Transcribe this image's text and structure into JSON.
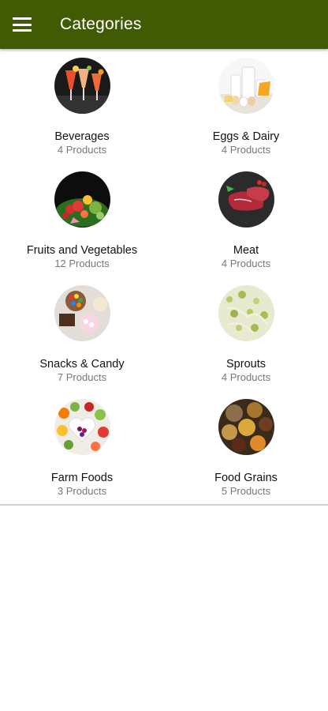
{
  "appbar": {
    "title": "Categories",
    "menu_icon": "hamburger-menu-icon",
    "color": "#405b04"
  },
  "categories": [
    {
      "name": "Beverages",
      "count": "4 Products",
      "image": "beverages-image"
    },
    {
      "name": "Eggs & Dairy",
      "count": "4 Products",
      "image": "eggs-dairy-image"
    },
    {
      "name": "Fruits and Vegetables",
      "count": "12 Products",
      "image": "fruits-vegetables-image"
    },
    {
      "name": "Meat",
      "count": "4 Products",
      "image": "meat-image"
    },
    {
      "name": "Snacks & Candy",
      "count": "7 Products",
      "image": "snacks-candy-image"
    },
    {
      "name": "Sprouts",
      "count": "4 Products",
      "image": "sprouts-image"
    },
    {
      "name": "Farm Foods",
      "count": "3 Products",
      "image": "farm-foods-image"
    },
    {
      "name": "Food Grains",
      "count": "5 Products",
      "image": "food-grains-image"
    }
  ]
}
